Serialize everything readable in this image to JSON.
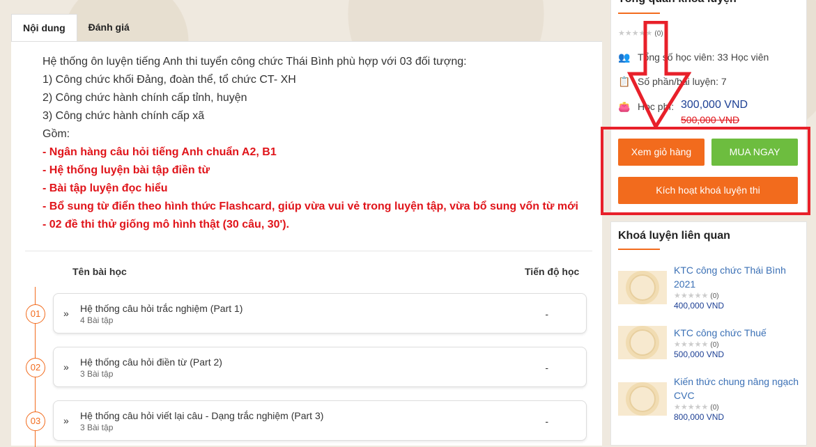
{
  "tabs": [
    {
      "label": "Nội dung",
      "active": true
    },
    {
      "label": "Đánh giá",
      "active": false
    }
  ],
  "content": {
    "lines": [
      "Hệ thống ôn luyện tiếng Anh thi tuyển công chức Thái Bình phù hợp với 03 đối tượng:",
      "1) Công chức khối Đảng, đoàn thể, tổ chức CT- XH",
      "2) Công chức hành chính cấp tỉnh, huyện",
      "3) Công chức hành chính cấp xã",
      "Gồm:"
    ],
    "highlights": [
      "- Ngân hàng câu hỏi tiếng Anh chuẩn A2, B1",
      "- Hệ thống luyện bài tập điền từ",
      "- Bài tập luyện đọc hiểu",
      "- Bổ sung từ điển theo hình thức Flashcard, giúp vừa vui vẻ trong luyện tập, vừa bổ sung vốn từ mới",
      "- 02 đề thi thử giống mô hình thật (30 câu, 30')."
    ]
  },
  "table": {
    "col_lesson": "Tên bài học",
    "col_progress": "Tiến độ học",
    "rows": [
      {
        "num": "01",
        "title": "Hệ thống câu hỏi trắc nghiệm (Part 1)",
        "count": "4 Bài tập",
        "progress": "-"
      },
      {
        "num": "02",
        "title": "Hệ thống câu hỏi điền từ (Part 2)",
        "count": "3 Bài tập",
        "progress": "-"
      },
      {
        "num": "03",
        "title": "Hệ thống câu hỏi viết lại câu - Dạng trắc nghiệm (Part 3)",
        "count": "3 Bài tập",
        "progress": "-"
      }
    ]
  },
  "overview": {
    "title": "Tổng quan khoá luyện",
    "rating_count": "(0)",
    "students": "Tổng số học viên: 33 Học viên",
    "parts": "Số phần/bài luyện: 7",
    "fee_label": "Học phí:",
    "price": "300,000 VND",
    "old_price": "500,000 VND",
    "btn_cart": "Xem giỏ hàng",
    "btn_buy": "MUA NGAY",
    "btn_activate": "Kích hoạt khoá luyện thi"
  },
  "related": {
    "title": "Khoá luyện liên quan",
    "items": [
      {
        "title": "KTC công chức Thái Bình 2021",
        "rating": "(0)",
        "price": "400,000 VND"
      },
      {
        "title": "KTC công chức Thuế",
        "rating": "(0)",
        "price": "500,000 VND"
      },
      {
        "title": "Kiến thức chung nâng ngạch CVC",
        "rating": "(0)",
        "price": "800,000 VND"
      }
    ]
  },
  "colors": {
    "accent": "#f26b1d",
    "buy": "#6dbd3f",
    "highlight": "#e8202a",
    "price": "#1c3f94"
  },
  "icons": [
    "users-icon",
    "clipboard-icon",
    "wallet-icon",
    "star-icon",
    "chevron-right-icon",
    "down-arrow-annotation"
  ]
}
